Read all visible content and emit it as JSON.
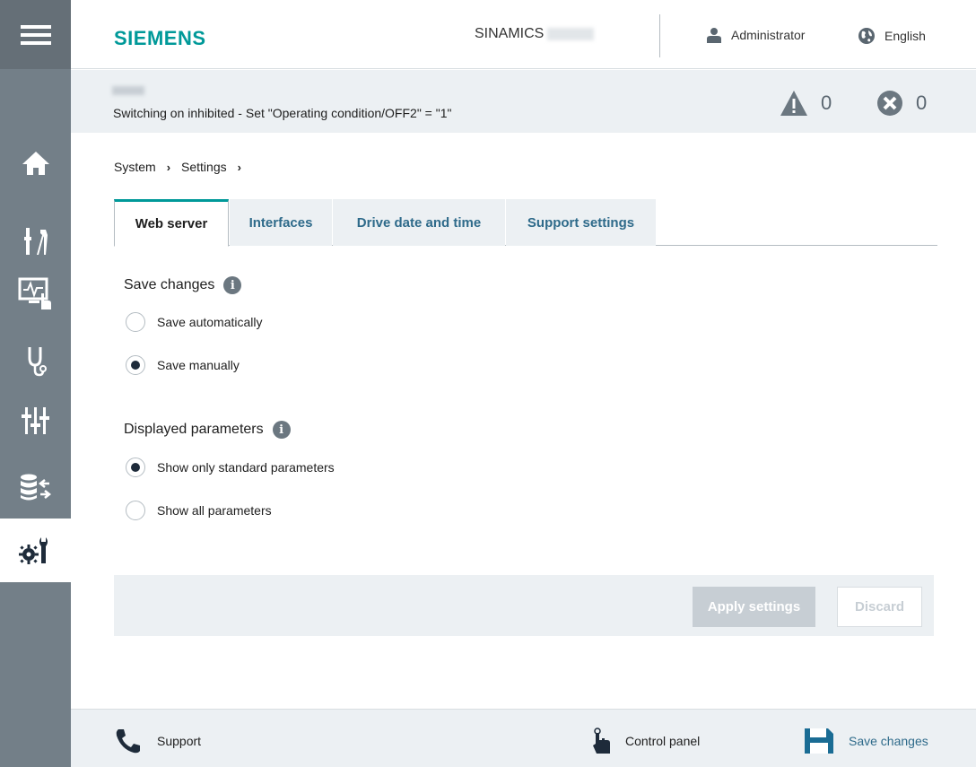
{
  "header": {
    "logo": "SIEMENS",
    "product": "SINAMICS",
    "user": "Administrator",
    "language": "English"
  },
  "status": {
    "message": "Switching on inhibited - Set \"Operating condition/OFF2\" = \"1\"",
    "warnings": "0",
    "errors": "0"
  },
  "breadcrumb": [
    "System",
    "Settings"
  ],
  "tabs": [
    {
      "label": "Web server",
      "active": true
    },
    {
      "label": "Interfaces",
      "active": false
    },
    {
      "label": "Drive date and time",
      "active": false
    },
    {
      "label": "Support settings",
      "active": false
    }
  ],
  "save_changes": {
    "title": "Save changes",
    "options": [
      {
        "label": "Save automatically",
        "checked": false
      },
      {
        "label": "Save manually",
        "checked": true
      }
    ]
  },
  "displayed_parameters": {
    "title": "Displayed parameters",
    "options": [
      {
        "label": "Show only standard parameters",
        "checked": true
      },
      {
        "label": "Show all parameters",
        "checked": false
      }
    ]
  },
  "actions": {
    "apply": "Apply settings",
    "discard": "Discard"
  },
  "footer": {
    "support": "Support",
    "control_panel": "Control panel",
    "save_changes": "Save changes"
  },
  "sidebar": {
    "items": [
      "menu-icon",
      "home-icon",
      "tools-icon",
      "monitor-touch-icon",
      "stethoscope-icon",
      "sliders-icon",
      "database-transfer-icon",
      "settings-wrench-icon"
    ]
  },
  "colors": {
    "brand": "#009999",
    "sidebar": "#737f88",
    "link": "#2e6a8a",
    "panel": "#ecf0f3"
  }
}
